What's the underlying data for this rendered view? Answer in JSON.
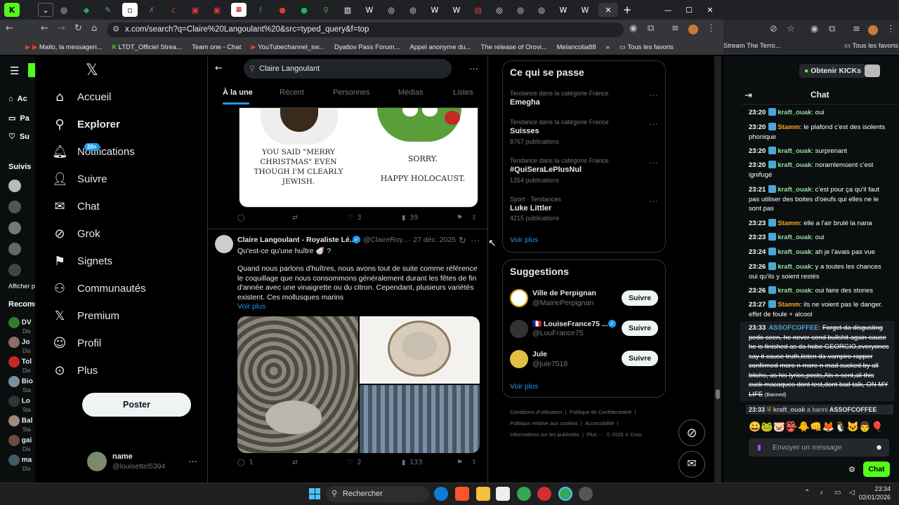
{
  "browser": {
    "url": "x.com/search?q=Claire%20Langoulant%20&src=typed_query&f=top",
    "bookmarks": [
      "Mailo, la messageri...",
      "LTDT_Officiel Strea...",
      "Team one - Chat",
      "YouTubechannel_sw...",
      "Dyatlov Pass Forum...",
      "Appel anonyme du...",
      "The release of Orovi...",
      "Melancolia88",
      "Tous les favoris",
      "Stream The Terro...",
      "Tous les favoris"
    ]
  },
  "kick_left": {
    "items": [
      "Ac",
      "Pa",
      "Su"
    ],
    "section_followed": "Suivis",
    "show_more": "Afficher p",
    "section_recommended": "Recomm",
    "rec_items": [
      "DV",
      "Jo",
      "Tol",
      "Bio",
      "Lo",
      "Bal",
      "gai",
      "ma"
    ],
    "rec_sub": [
      "Dis",
      "Dis",
      "Dis",
      "Sta",
      "Sta",
      "Sta",
      "Dis",
      "Dis"
    ]
  },
  "xnav": {
    "items": [
      "Accueil",
      "Explorer",
      "Notifications",
      "Suivre",
      "Chat",
      "Grok",
      "Signets",
      "Communautés",
      "Premium",
      "Profil",
      "Plus"
    ],
    "notif_badge": "20+",
    "post_button": "Poster",
    "account_name": "name",
    "account_handle": "@louisettel5394"
  },
  "search": {
    "query": "Claire Langoulant",
    "tabs": [
      "À la une",
      "Récent",
      "Personnes",
      "Médias",
      "Listes"
    ]
  },
  "meme": {
    "left_text": "You said \"Merry Christmas\" even though I'm clearly Jewish.",
    "right_text_1": "Sorry.",
    "right_text_2": "Happy Holocaust."
  },
  "tweet1": {
    "likes": "3",
    "views": "39"
  },
  "tweet2": {
    "author": "Claire Langoulant - Royaliste Lé...",
    "handle": "@ClaireRoy...",
    "date": "· 27 déc. 2025",
    "headline": "Qu'est-ce qu'une huître 🦪 ?",
    "body": "Quand nous parlons d'huîtres, nous avons tout de suite comme référence le coquillage que nous consommons généralement durant les fêtes de fin d'année avec une vinaigrette ou du citron. Cependant, plusieurs variétés existent. Ces mollusques marins",
    "more": "Voir plus",
    "replies": "1",
    "likes": "2",
    "views": "133"
  },
  "trends": {
    "title": "Ce qui se passe",
    "items": [
      {
        "cat": "Tendance dans la catégorie France",
        "name": "Emegha",
        "count": ""
      },
      {
        "cat": "Tendance dans la catégorie France",
        "name": "Suisses",
        "count": "8767 publications"
      },
      {
        "cat": "Tendance dans la catégorie France",
        "name": "#QuiSeraLePlusNul",
        "count": "1354 publications"
      },
      {
        "cat": "Sport · Tendances",
        "name": "Luke Littler",
        "count": "4215 publications"
      }
    ],
    "more": "Voir plus"
  },
  "suggestions": {
    "title": "Suggestions",
    "items": [
      {
        "name": "Ville de Perpignan",
        "handle": "@MairiePerpignan"
      },
      {
        "name": "🇫🇷 LouiseFrance75 ...",
        "handle": "@LouFrance75"
      },
      {
        "name": "Jule",
        "handle": "@jule7518"
      }
    ],
    "follow_label": "Suivre",
    "more": "Voir plus"
  },
  "footer": {
    "links": [
      "Conditions d'utilisation",
      "Politique de Confidentialité",
      "Politique relative aux cookies",
      "Accessibilité",
      "Informations sur les publicités",
      "Plus ···",
      "© 2026 X Corp."
    ]
  },
  "kick": {
    "get_kicks": "Obtenir KICKs",
    "chat_title": "Chat",
    "messages": [
      {
        "time": "23:20",
        "user": "kraft_ouak",
        "text": "oui",
        "color": "#8ee39b"
      },
      {
        "time": "23:20",
        "user": "Stamm",
        "text": "le plafond c'est des isolents phonique",
        "color": "#f5a623"
      },
      {
        "time": "23:20",
        "user": "kraft_ouak",
        "text": "surprenant",
        "color": "#8ee39b"
      },
      {
        "time": "23:20",
        "user": "kraft_ouak",
        "text": "noramlemùent c'est ignifugé",
        "color": "#8ee39b"
      },
      {
        "time": "23:21",
        "user": "kraft_ouak",
        "text": "c'est pour ça qu'il faut pas utiliser des boites d'oeufs qui elles ne le sont pas",
        "color": "#8ee39b"
      },
      {
        "time": "23:23",
        "user": "Stamm",
        "text": "elle a l'air brulé la nana",
        "color": "#f5a623"
      },
      {
        "time": "23:23",
        "user": "kraft_ouak",
        "text": "oui",
        "color": "#8ee39b"
      },
      {
        "time": "23:24",
        "user": "kraft_ouak",
        "text": "ah je l'avais pas vue",
        "color": "#8ee39b"
      },
      {
        "time": "23:26",
        "user": "kraft_ouak",
        "text": "y a toutes les chances oui qu'ils y soient restés",
        "color": "#8ee39b"
      },
      {
        "time": "23:26",
        "user": "kraft_ouak",
        "text": "oui faire des stories",
        "color": "#8ee39b"
      },
      {
        "time": "23:27",
        "user": "Stamm",
        "text": "ils ne voient pas le danger. effet de foule + alcool",
        "color": "#f5a623"
      }
    ],
    "banned_msg": {
      "time": "23:33",
      "user": "ASSOFCOFFEE",
      "text": "Forget da disgusting pedo seen, he never send bullshit again cause he is finished as da hobo GEORGIO,everyones say it cause truth,listen da vampire rapper confirmed more n more n mad sucked by all bitchs, as his lyrics,posts,Als n sent,all this cuck macaques dont test,dont bad talk, ON MY LIFE",
      "tag": "(Banned)"
    },
    "ban_notice": {
      "time": "23:33",
      "user": "kraft_ouak",
      "action": "a banni",
      "target": "ASSOFCOFFEE"
    },
    "input_placeholder": "Envoyer un message",
    "send": "Chat"
  },
  "taskbar": {
    "search": "Rechercher",
    "time": "23:34",
    "date": "02/01/2026"
  }
}
